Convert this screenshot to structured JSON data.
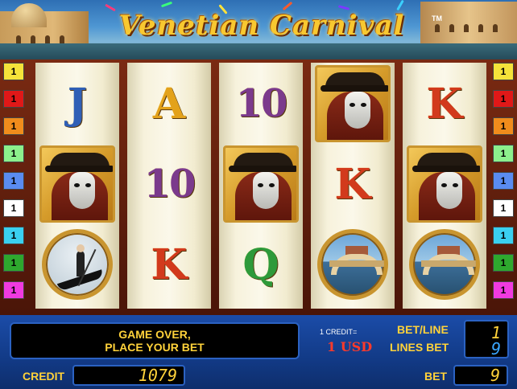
{
  "header": {
    "title": "Venetian Carnival",
    "trademark": "TM"
  },
  "reels": [
    [
      {
        "type": "letter",
        "text": "J",
        "color": "#2f5fb6"
      },
      {
        "type": "mask"
      },
      {
        "type": "gondola"
      }
    ],
    [
      {
        "type": "letter",
        "text": "A",
        "color": "#e3a21a"
      },
      {
        "type": "number",
        "text": "10",
        "color": "#7b3a8c"
      },
      {
        "type": "letter",
        "text": "K",
        "color": "#d23a1c"
      }
    ],
    [
      {
        "type": "number",
        "text": "10",
        "color": "#7b3a8c"
      },
      {
        "type": "mask"
      },
      {
        "type": "letter",
        "text": "Q",
        "color": "#2e9a3a"
      }
    ],
    [
      {
        "type": "mask"
      },
      {
        "type": "letter",
        "text": "K",
        "color": "#d23a1c"
      },
      {
        "type": "bridge"
      }
    ],
    [
      {
        "type": "letter",
        "text": "K",
        "color": "#d23a1c"
      },
      {
        "type": "mask"
      },
      {
        "type": "bridge"
      }
    ]
  ],
  "line_markers": {
    "left": [
      {
        "label": "1",
        "color": "#f5e33a"
      },
      {
        "label": "1",
        "color": "#e01818"
      },
      {
        "label": "1",
        "color": "#f08c1c"
      },
      {
        "label": "1",
        "color": "#8cf08c"
      },
      {
        "label": "1",
        "color": "#5a8cf0"
      },
      {
        "label": "1",
        "color": "#ffffff"
      },
      {
        "label": "1",
        "color": "#3ad0f0"
      },
      {
        "label": "1",
        "color": "#2ea82e"
      },
      {
        "label": "1",
        "color": "#f03ae0"
      }
    ],
    "right": [
      {
        "label": "1",
        "color": "#f5e33a"
      },
      {
        "label": "1",
        "color": "#e01818"
      },
      {
        "label": "1",
        "color": "#f08c1c"
      },
      {
        "label": "1",
        "color": "#8cf08c"
      },
      {
        "label": "1",
        "color": "#5a8cf0"
      },
      {
        "label": "1",
        "color": "#ffffff"
      },
      {
        "label": "1",
        "color": "#3ad0f0"
      },
      {
        "label": "1",
        "color": "#2ea82e"
      },
      {
        "label": "1",
        "color": "#f03ae0"
      }
    ]
  },
  "panel": {
    "message_line1": "GAME OVER,",
    "message_line2": "PLACE YOUR BET",
    "credit_equals": "1 CREDIT=",
    "denomination": "1 USD",
    "bet_line_label": "BET/LINE",
    "lines_bet_label": "LINES BET",
    "bet_per_line": "1",
    "lines_bet": "9",
    "credit_label": "CREDIT",
    "credit_value": "1079",
    "bet_label": "BET",
    "bet_value": "9"
  }
}
